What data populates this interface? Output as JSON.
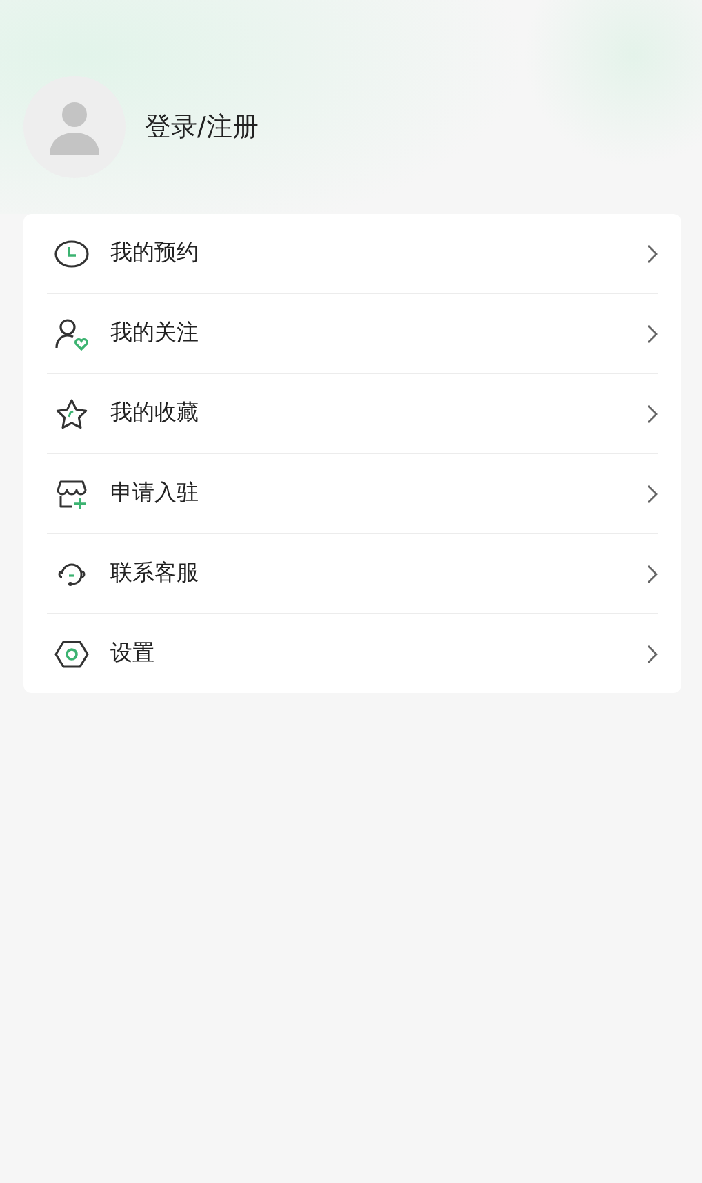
{
  "profile": {
    "login_label": "登录/注册"
  },
  "menu": [
    {
      "label": "我的预约"
    },
    {
      "label": "我的关注"
    },
    {
      "label": "我的收藏"
    },
    {
      "label": "申请入驻"
    },
    {
      "label": "联系客服"
    },
    {
      "label": "设置"
    }
  ]
}
